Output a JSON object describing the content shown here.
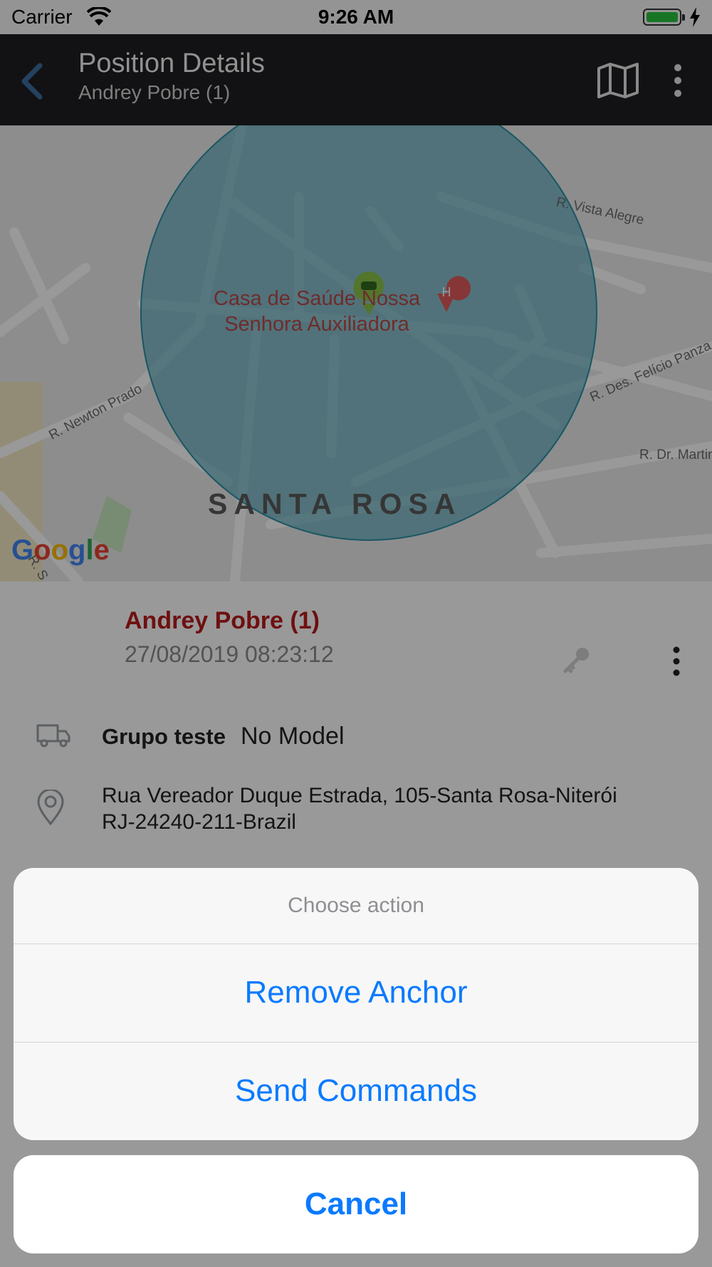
{
  "status_bar": {
    "carrier": "Carrier",
    "time": "9:26 AM"
  },
  "app_bar": {
    "title": "Position Details",
    "subtitle": "Andrey Pobre (1)"
  },
  "map": {
    "poi_line1": "Casa de Saúde Nossa",
    "poi_line2": "Senhora Auxiliadora",
    "poi_icon_letter": "H",
    "district": "SANTA ROSA",
    "streets": {
      "vista_alegre": "R. Vista Alegre",
      "felicio_panza": "R. Des. Felício Panza",
      "newton_prado": "R. Newton Prado",
      "dr_martins": "R. Dr. Martin",
      "partial": "R. S"
    },
    "attribution": [
      "G",
      "o",
      "o",
      "g",
      "l",
      "e"
    ],
    "anchor_fill": "#4aa3b8",
    "marker_color": "#8bc34a"
  },
  "details": {
    "device_name": "Andrey Pobre (1)",
    "datetime": "27/08/2019 08:23:12",
    "group": "Grupo teste",
    "model": "No Model",
    "address_line1": "Rua Vereador Duque Estrada, 105-Santa Rosa-Niterói",
    "address_line2": "RJ-24240-211-Brazil",
    "device_name_color": "#b71c1c"
  },
  "action_sheet": {
    "title": "Choose action",
    "actions": [
      "Remove Anchor",
      "Send Commands"
    ],
    "cancel": "Cancel",
    "accent": "#0a7aff"
  }
}
